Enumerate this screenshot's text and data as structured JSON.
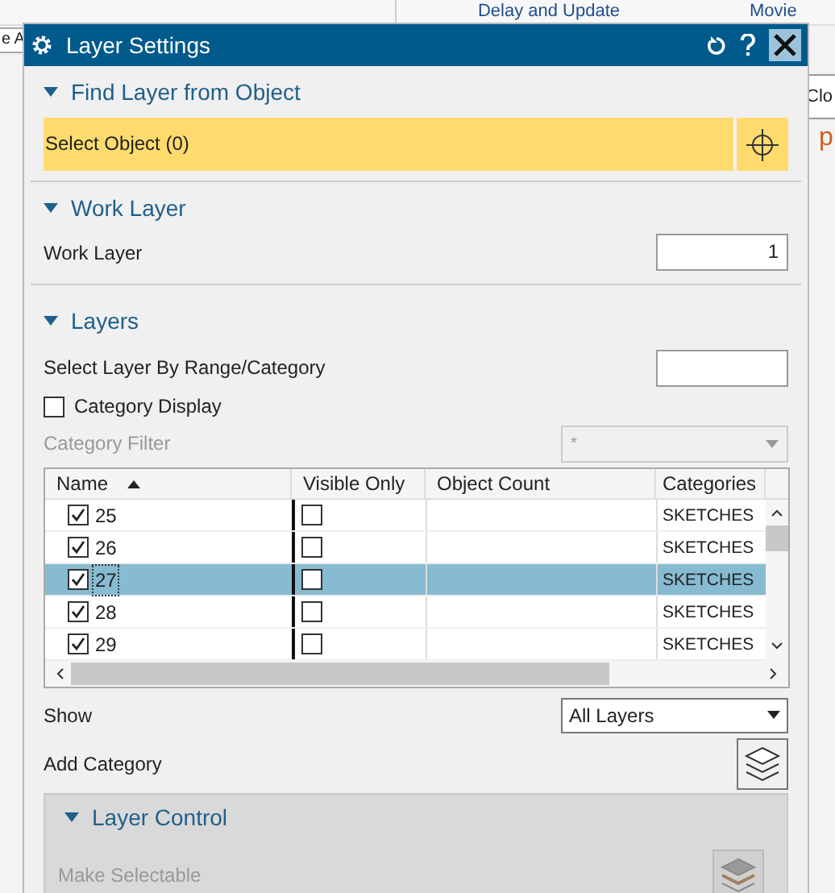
{
  "background": {
    "toolbar_labels": [
      "Delay and Update",
      "Movie"
    ],
    "left_field": "e A",
    "tooltip": "Clo",
    "right_text": "p"
  },
  "window": {
    "title": "Layer Settings"
  },
  "find_layer": {
    "title": "Find Layer from Object",
    "expanded": true,
    "select_label": "Select Object (0)"
  },
  "work_layer": {
    "title": "Work Layer",
    "expanded": true,
    "label": "Work Layer",
    "value": "1"
  },
  "layers": {
    "title": "Layers",
    "expanded": true,
    "range_label": "Select Layer By Range/Category",
    "category_display": {
      "label": "Category Display",
      "checked": false
    },
    "category_filter": {
      "label": "Category Filter",
      "value": "*",
      "disabled": true
    },
    "table": {
      "columns": [
        "Name",
        "Visible Only",
        "Object Count",
        "Categories"
      ],
      "rows": [
        {
          "name": "25",
          "checked": true,
          "visible_only": false,
          "selected": false,
          "categories": "SKETCHES"
        },
        {
          "name": "26",
          "checked": true,
          "visible_only": false,
          "selected": false,
          "categories": "SKETCHES"
        },
        {
          "name": "27",
          "checked": true,
          "visible_only": false,
          "selected": true,
          "categories": "SKETCHES"
        },
        {
          "name": "28",
          "checked": true,
          "visible_only": false,
          "selected": false,
          "categories": "SKETCHES"
        },
        {
          "name": "29",
          "checked": true,
          "visible_only": false,
          "selected": false,
          "categories": "SKETCHES"
        }
      ]
    },
    "show": {
      "label": "Show",
      "value": "All Layers"
    },
    "add_category": {
      "label": "Add Category"
    }
  },
  "layer_control": {
    "title": "Layer Control",
    "expanded": true,
    "items": [
      {
        "label": "Make Selectable",
        "disabled": true
      }
    ]
  }
}
